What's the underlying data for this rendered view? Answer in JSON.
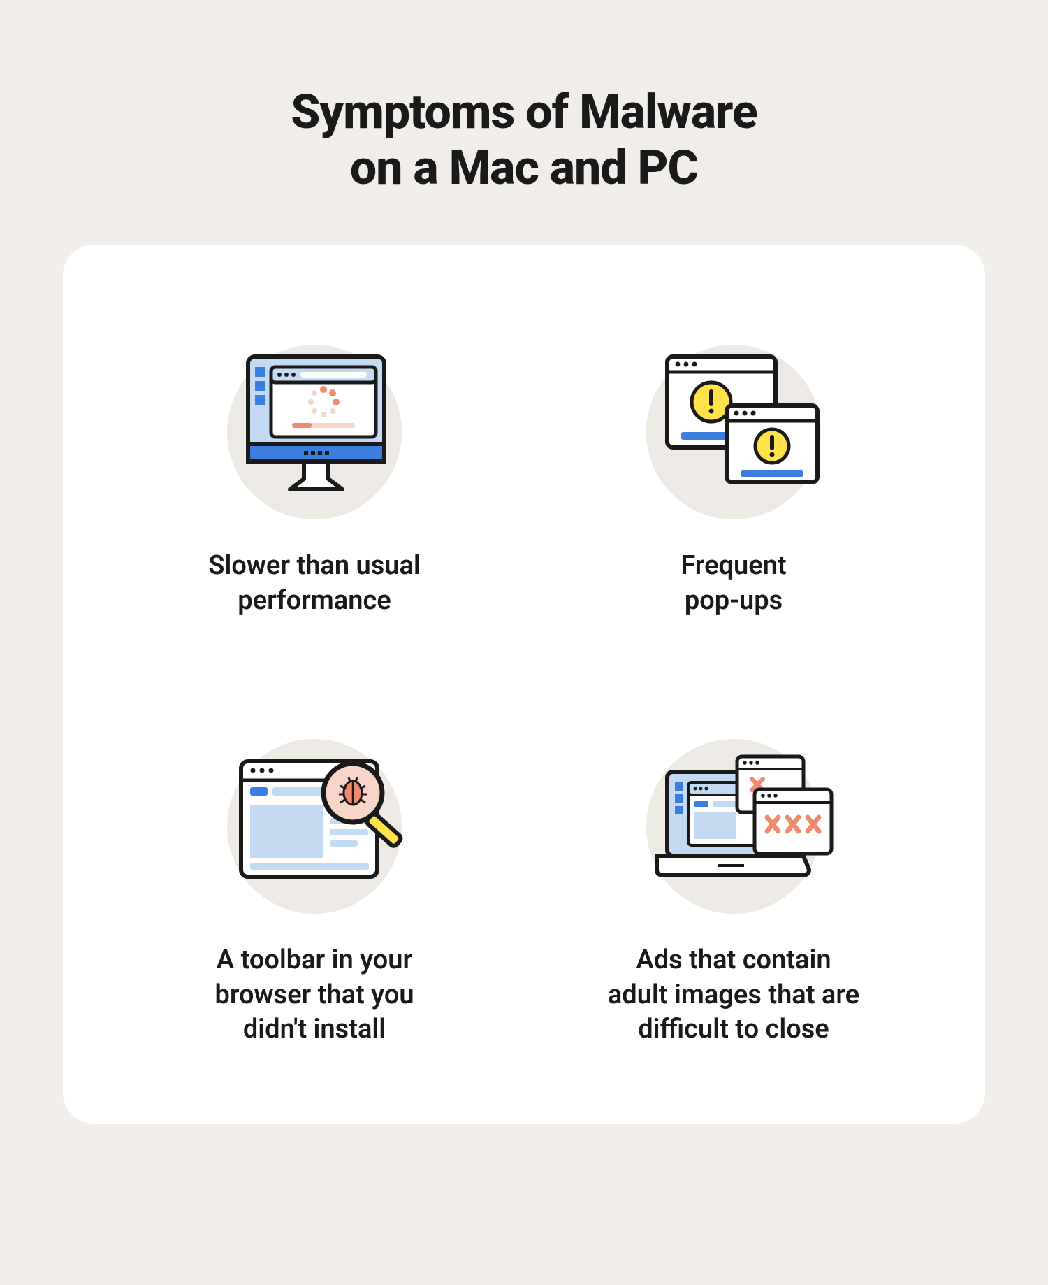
{
  "title_line1": "Symptoms of Malware",
  "title_line2": "on a Mac and PC",
  "items": [
    {
      "icon": "slow-computer-icon",
      "caption": "Slower than usual\nperformance"
    },
    {
      "icon": "popups-icon",
      "caption": "Frequent\npop-ups"
    },
    {
      "icon": "toolbar-bug-icon",
      "caption": "A toolbar in your\nbrowser that you\ndidn't install"
    },
    {
      "icon": "adult-ads-icon",
      "caption": "Ads that contain\nadult images that are\ndifficult to close"
    }
  ],
  "colors": {
    "page_bg": "#f1ede8",
    "card_bg": "#ffffff",
    "text": "#1a1a1a",
    "stroke": "#1a1a1a",
    "light_blue": "#c4d9f2",
    "blue": "#3e7de0",
    "salmon": "#f08a6e",
    "pink": "#f9d4c9",
    "yellow": "#ffe24b",
    "circle_bg": "#edeae5"
  }
}
